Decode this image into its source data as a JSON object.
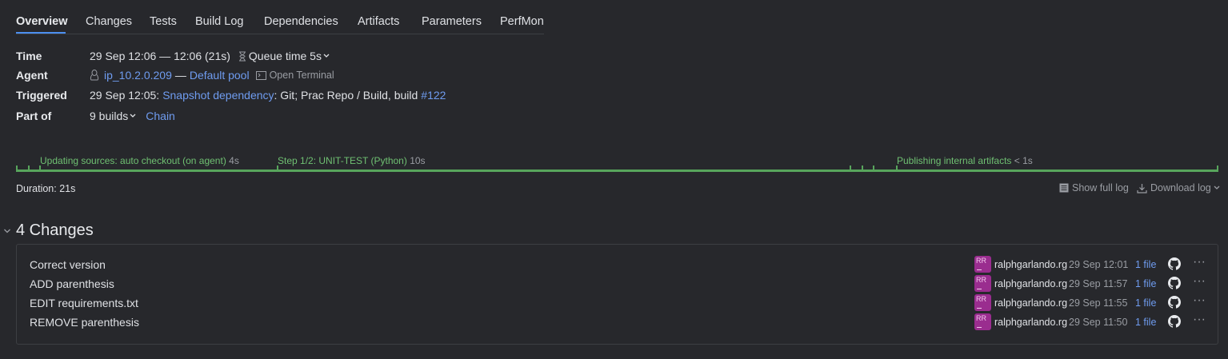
{
  "tabs": [
    "Overview",
    "Changes",
    "Tests",
    "Build Log",
    "Dependencies",
    "Artifacts",
    "Parameters",
    "PerfMon"
  ],
  "info": {
    "time_label": "Time",
    "time_value": "29 Sep 12:06 — 12:06 (21s)",
    "queue_time": "Queue time 5s",
    "agent_label": "Agent",
    "agent_name": "ip_10.2.0.209",
    "agent_sep": "—",
    "agent_pool": "Default pool",
    "open_terminal": "Open Terminal",
    "triggered_label": "Triggered",
    "triggered_prefix": "29 Sep 12:05:",
    "triggered_link": "Snapshot dependency",
    "triggered_mid": ": Git; Prac Repo / Build, build",
    "triggered_build": "#122",
    "partof_label": "Part of",
    "partof_builds": "9 builds",
    "partof_chain": "Chain"
  },
  "timeline": {
    "stages": [
      {
        "label": "Updating sources: auto checkout (on agent)",
        "duration": "4s"
      },
      {
        "label": "Step 1/2: UNIT-TEST (Python)",
        "duration": "10s"
      },
      {
        "label": "Publishing internal artifacts",
        "duration": "< 1s"
      }
    ],
    "color": "#58a55c"
  },
  "duration": "Duration: 21s",
  "log_actions": {
    "show_full_log": "Show full log",
    "download_log": "Download log"
  },
  "changes": {
    "title": "4 Changes",
    "items": [
      {
        "message": "Correct version",
        "avatar": "RR",
        "user": "ralphgarlando.rg",
        "date": "29 Sep 12:01",
        "files": "1 file"
      },
      {
        "message": "ADD parenthesis",
        "avatar": "RR",
        "user": "ralphgarlando.rg",
        "date": "29 Sep 11:57",
        "files": "1 file"
      },
      {
        "message": "EDIT requirements.txt",
        "avatar": "RR",
        "user": "ralphgarlando.rg",
        "date": "29 Sep 11:55",
        "files": "1 file"
      },
      {
        "message": "REMOVE parenthesis",
        "avatar": "RR",
        "user": "ralphgarlando.rg",
        "date": "29 Sep 11:50",
        "files": "1 file"
      }
    ],
    "more_glyph": "···"
  },
  "colors": {
    "accent": "#4c8ff0",
    "link": "#6f9cf0",
    "success": "#58a55c",
    "avatar": "#9a2d8f",
    "background": "#27282c"
  }
}
